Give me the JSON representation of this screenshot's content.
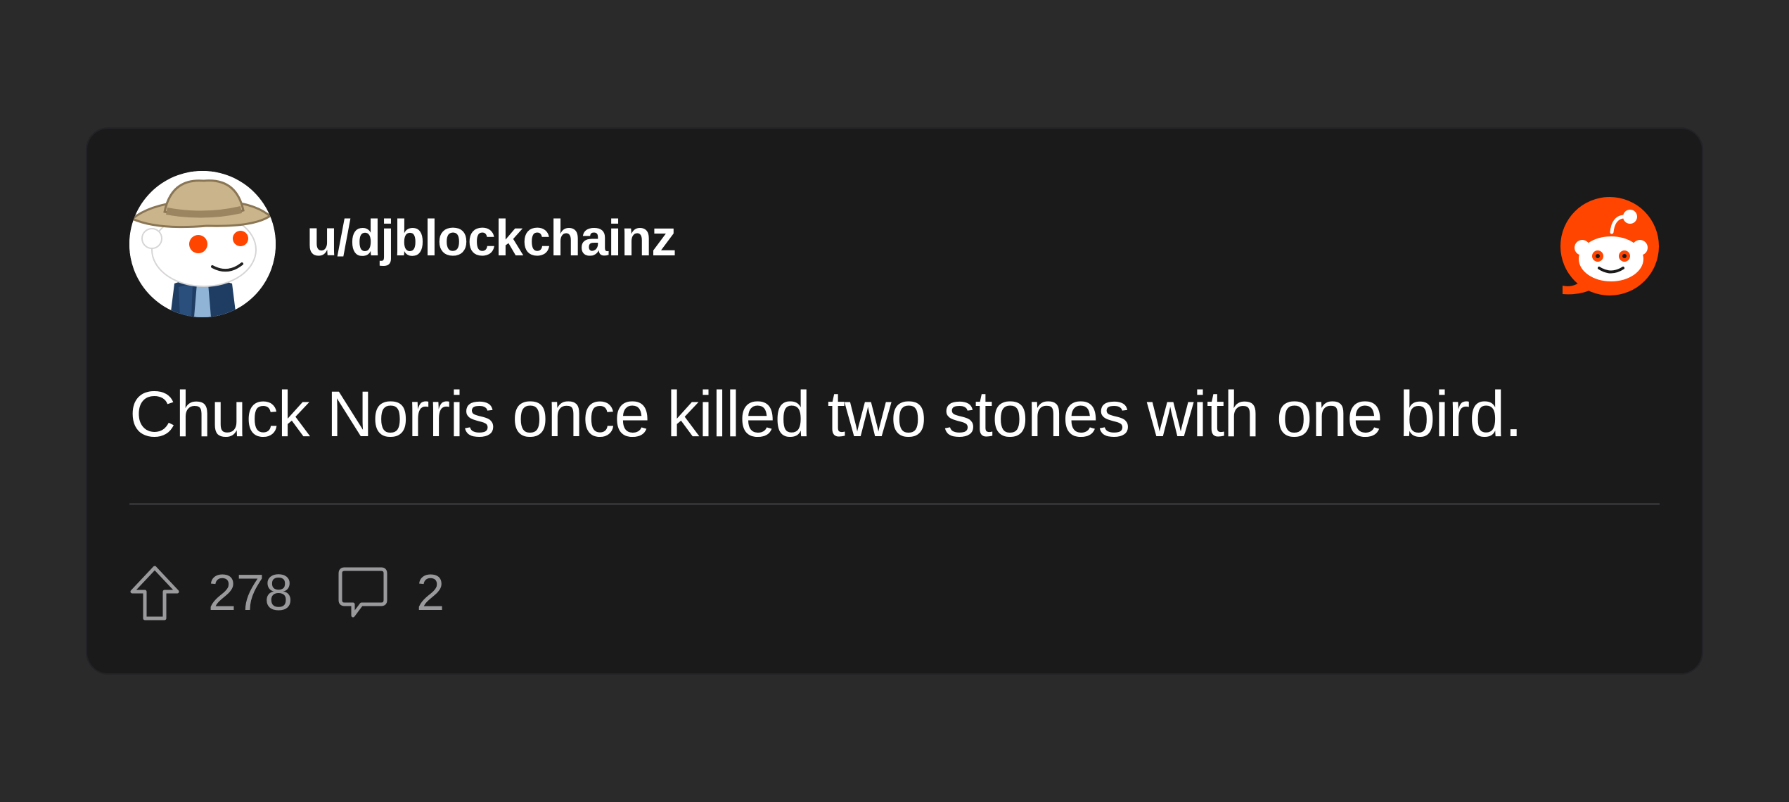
{
  "post": {
    "username": "u/djblockchainz",
    "text": "Chuck Norris once killed two stones with one bird.",
    "upvotes": "278",
    "comments": "2"
  },
  "icons": {
    "avatar": "snoo-cowboy-avatar",
    "brand": "reddit-logo-icon",
    "upvote": "upvote-arrow-icon",
    "comment": "comment-bubble-icon"
  },
  "colors": {
    "page_background": "#2a2a2b",
    "card_background": "#1a1a1b",
    "text_primary": "#ffffff",
    "text_secondary": "#9a9a9c",
    "reddit_orange": "#ff4500"
  }
}
